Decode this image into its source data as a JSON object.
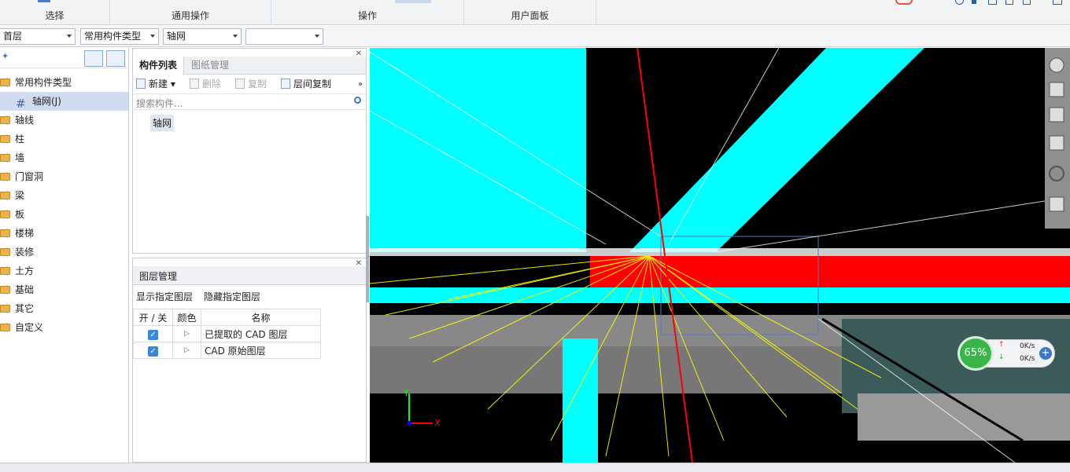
{
  "ribbon": {
    "groups": [
      {
        "label": "选择"
      },
      {
        "label": "通用操作"
      },
      {
        "label": "操作"
      },
      {
        "label": "用户面板"
      }
    ]
  },
  "filters": {
    "floor": "首层",
    "type": "常用构件类型",
    "component": "轴网",
    "extra": ""
  },
  "tree": {
    "root": "常用构件类型",
    "selected": "轴网(J)",
    "items": [
      "轴线",
      "柱",
      "墙",
      "门窗洞",
      "梁",
      "板",
      "楼梯",
      "装修",
      "土方",
      "基础",
      "其它",
      "自定义"
    ]
  },
  "component_panel": {
    "tab_active": "构件列表",
    "tab_inactive": "图纸管理",
    "toolbar": {
      "new": "新建",
      "delete": "删除",
      "copy": "复制",
      "floor_copy": "层间复制"
    },
    "search_placeholder": "搜索构件...",
    "items": [
      "轴网"
    ]
  },
  "layer_panel": {
    "title": "图层管理",
    "show": "显示指定图层",
    "hide": "隐藏指定图层",
    "headers": {
      "toggle": "开 / 关",
      "color": "颜色",
      "name": "名称"
    },
    "rows": [
      {
        "name": "已提取的 CAD 图层"
      },
      {
        "name": "CAD 原始图层"
      }
    ]
  },
  "net_widget": {
    "percent": "65%",
    "up": "0K/s",
    "down": "0K/s"
  },
  "axis": {
    "x": "X",
    "y": "Y"
  }
}
